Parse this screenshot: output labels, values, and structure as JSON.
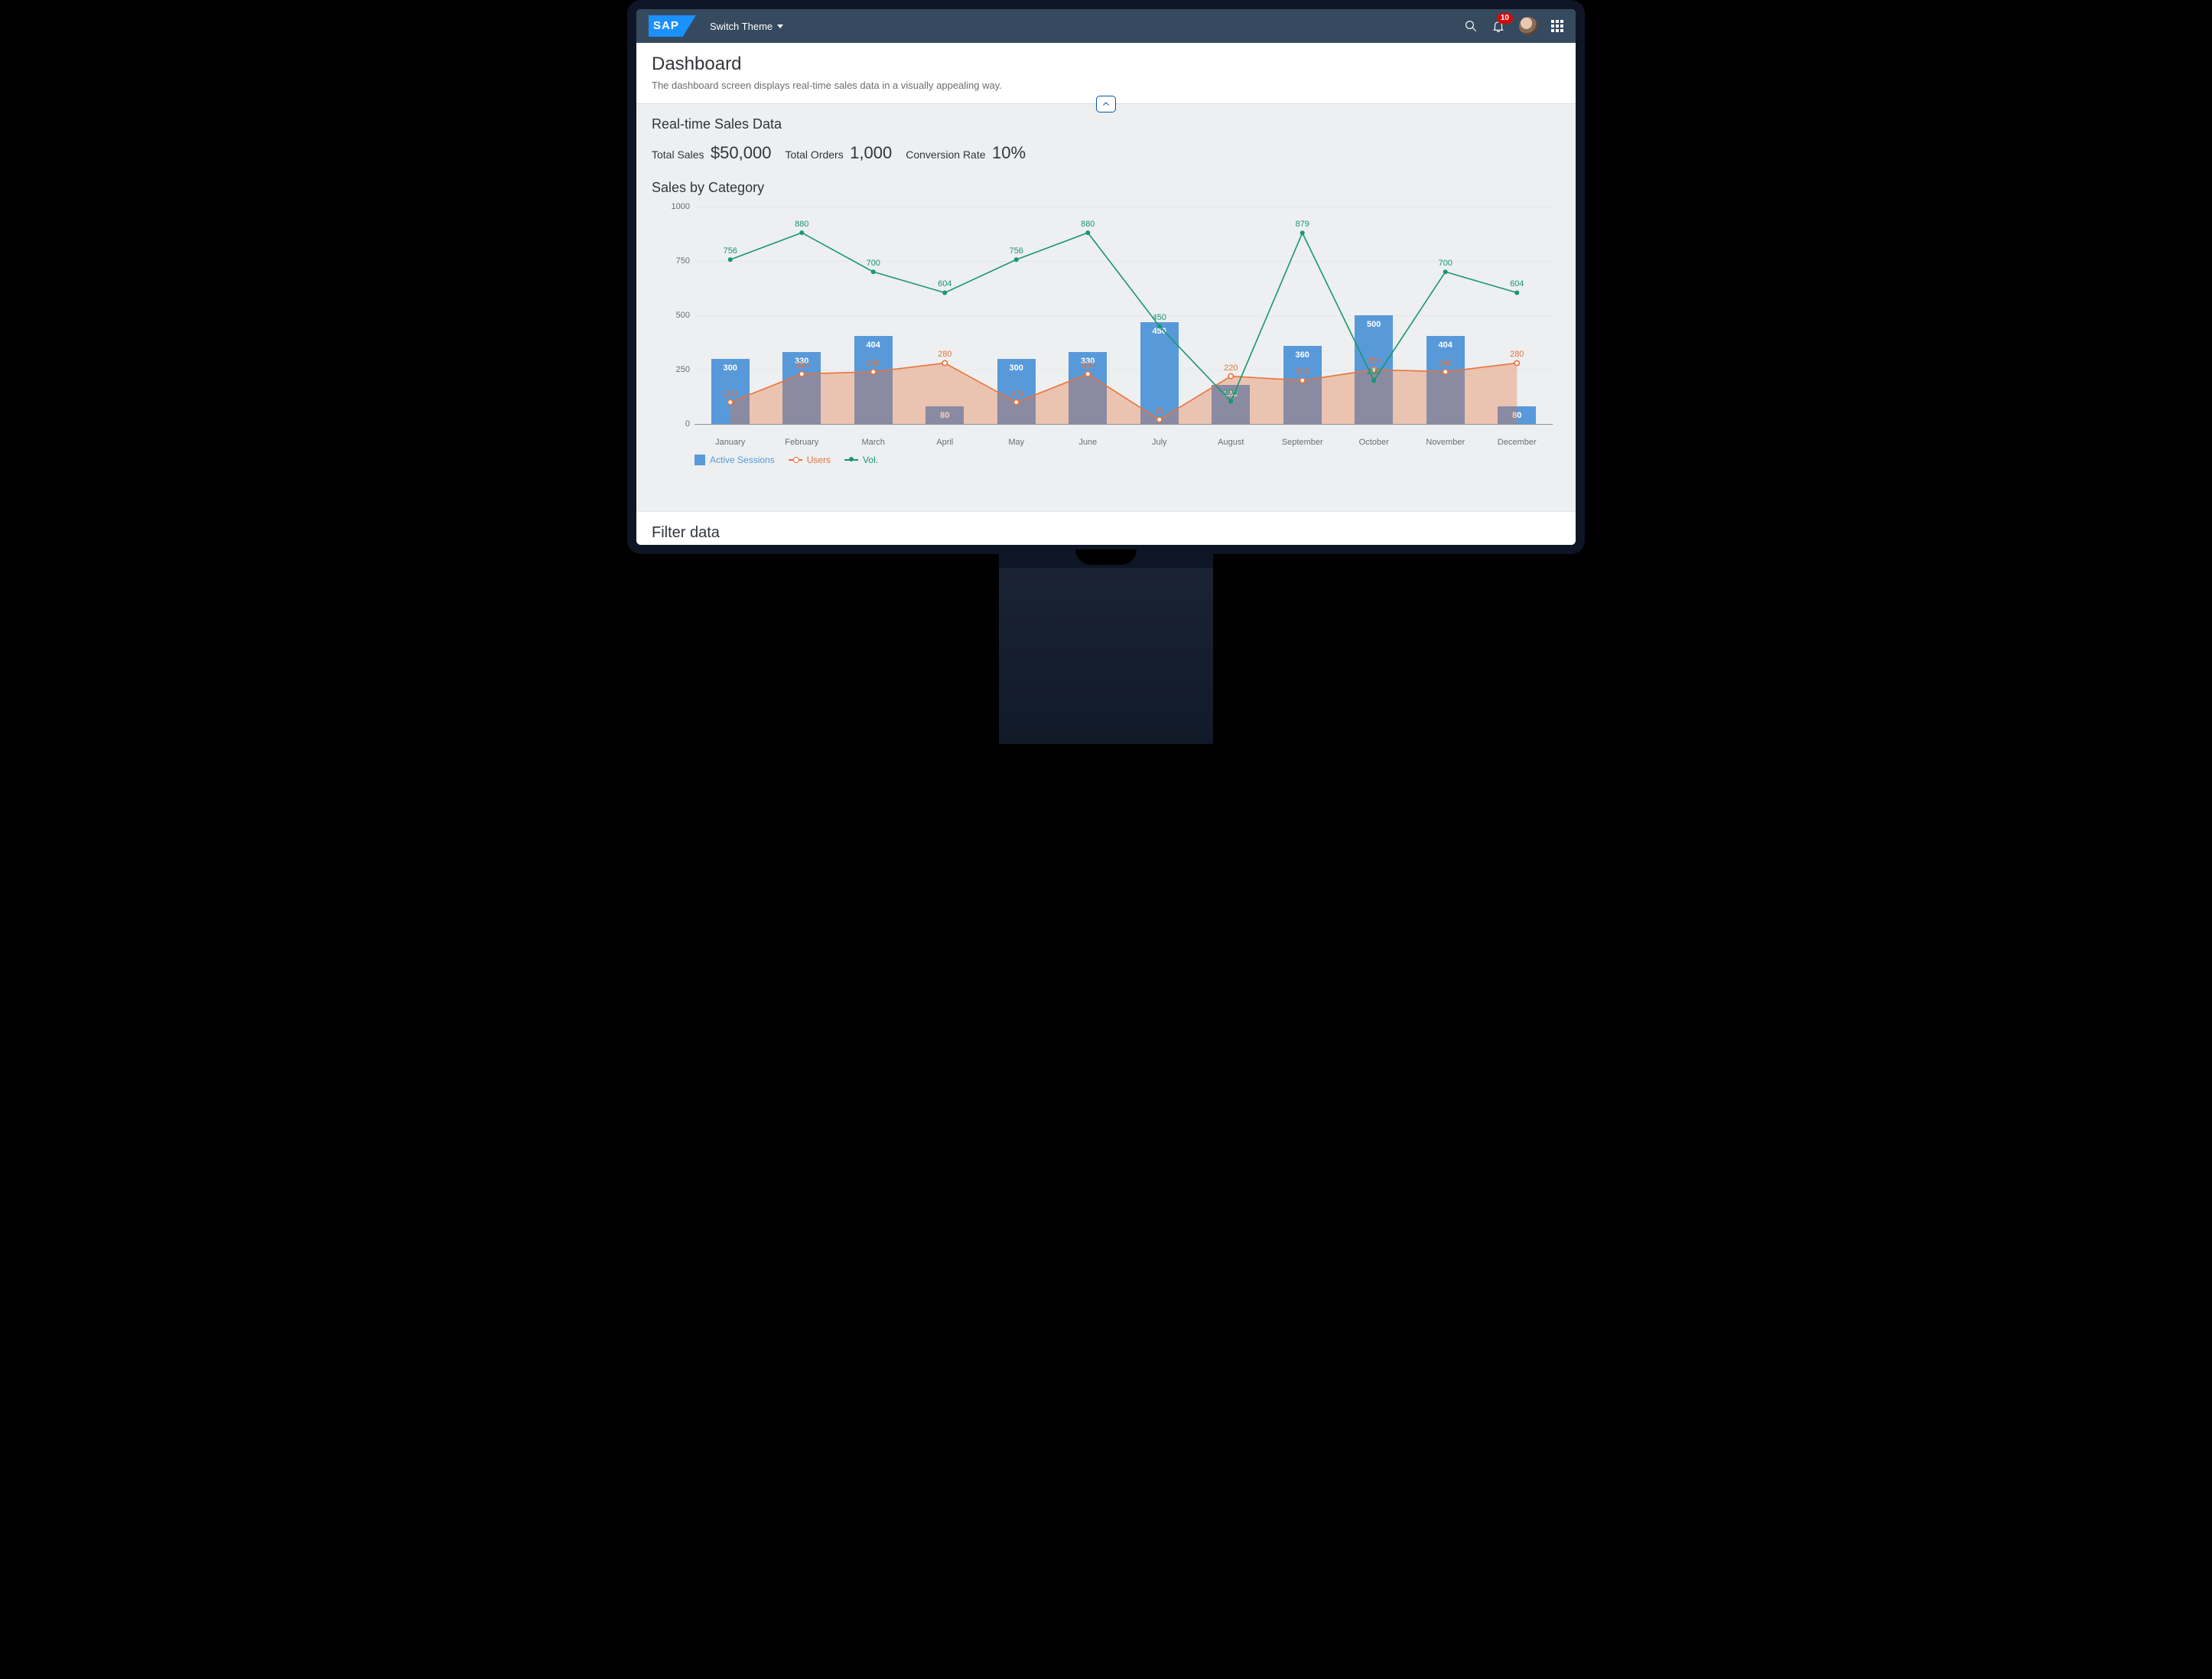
{
  "shell": {
    "logo_text": "SAP",
    "switch_theme": "Switch Theme",
    "notification_count": "10"
  },
  "header": {
    "title": "Dashboard",
    "subtitle": "The dashboard screen displays real-time sales data in a visually appealing way."
  },
  "realtime": {
    "title": "Real-time Sales Data",
    "kpis": [
      {
        "label": "Total Sales",
        "value": "$50,000"
      },
      {
        "label": "Total Orders",
        "value": "1,000"
      },
      {
        "label": "Conversion Rate",
        "value": "10%"
      }
    ]
  },
  "sales_by_cat": {
    "title": "Sales by Category",
    "legend": {
      "a": "Active Sessions",
      "b": "Users",
      "c": "Vol."
    }
  },
  "filter": {
    "title": "Filter data"
  },
  "chart_data": {
    "type": "bar",
    "title": "Sales by Category",
    "xlabel": "",
    "ylabel": "",
    "ylim": [
      0,
      1000
    ],
    "y_ticks": [
      0,
      250,
      500,
      750,
      1000
    ],
    "categories": [
      "January",
      "February",
      "March",
      "April",
      "May",
      "June",
      "July",
      "August",
      "September",
      "October",
      "November",
      "December"
    ],
    "series": [
      {
        "name": "Active Sessions",
        "type": "bar",
        "color": "#5899da",
        "values": [
          300,
          330,
          404,
          80,
          300,
          330,
          470,
          180,
          360,
          500,
          404,
          80
        ]
      },
      {
        "name": "Users",
        "type": "area",
        "color": "#e8743b",
        "values": [
          100,
          230,
          240,
          280,
          100,
          230,
          20,
          220,
          200,
          250,
          240,
          280
        ]
      },
      {
        "name": "Vol.",
        "type": "line",
        "color": "#19976f",
        "values": [
          756,
          880,
          700,
          604,
          756,
          880,
          450,
          104,
          879,
          200,
          700,
          604
        ]
      }
    ],
    "bar_top_labels": [
      300,
      330,
      404,
      80,
      300,
      330,
      450,
      180,
      360,
      500,
      404,
      80
    ]
  }
}
